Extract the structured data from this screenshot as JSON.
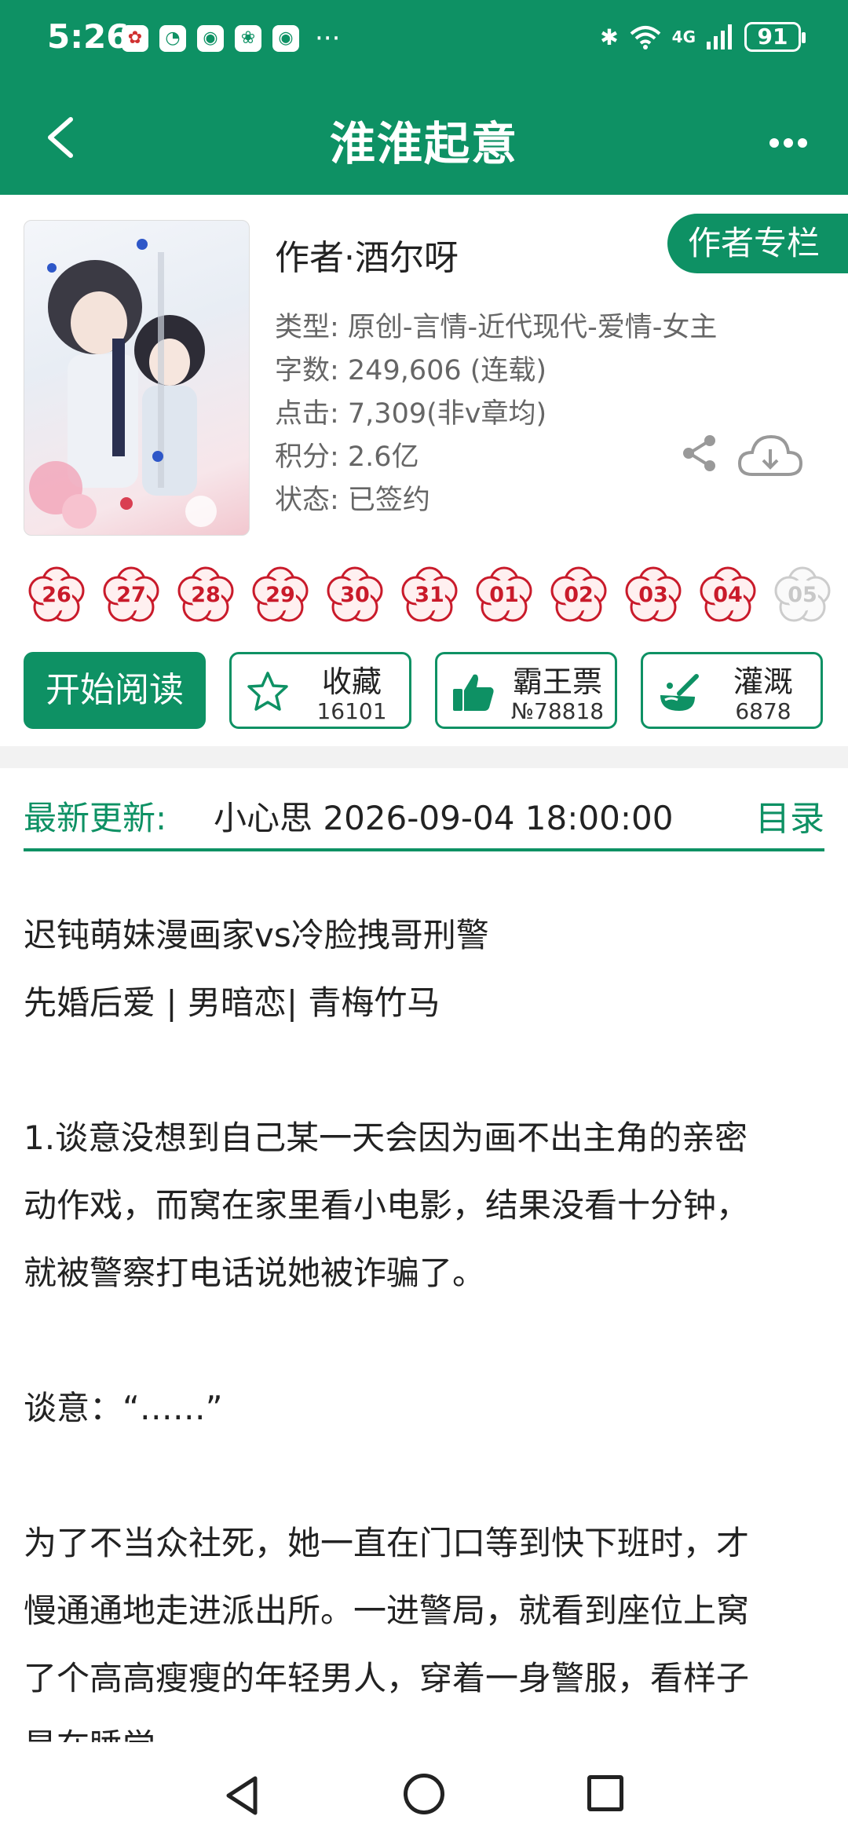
{
  "status_bar": {
    "time": "5:26",
    "network": "4G",
    "battery": "91"
  },
  "header": {
    "title": "淮淮起意",
    "back_icon": "chevron-left-icon",
    "more_icon": "more-dots-icon"
  },
  "book": {
    "author": "作者·酒尔呀",
    "author_column_label": "作者专栏",
    "meta": {
      "type": "类型: 原创-言情-近代现代-爱情-女主",
      "words": "字数: 249,606 (连载)",
      "clicks": "点击: 7,309(非v章均)",
      "points": "积分: 2.6亿",
      "status": "状态: 已签约"
    }
  },
  "update_days": [
    {
      "label": "26",
      "active": true
    },
    {
      "label": "27",
      "active": true
    },
    {
      "label": "28",
      "active": true
    },
    {
      "label": "29",
      "active": true
    },
    {
      "label": "30",
      "active": true
    },
    {
      "label": "31",
      "active": true
    },
    {
      "label": "01",
      "active": true
    },
    {
      "label": "02",
      "active": true
    },
    {
      "label": "03",
      "active": true
    },
    {
      "label": "04",
      "active": true
    },
    {
      "label": "05",
      "active": false
    }
  ],
  "actions": {
    "read_label": "开始阅读",
    "favorite": {
      "label": "收藏",
      "count": "16101"
    },
    "tickets": {
      "label": "霸王票",
      "count": "№78818"
    },
    "nutrient": {
      "label": "灌溉",
      "count": "6878"
    }
  },
  "latest": {
    "label": "最新更新:",
    "chapter": "小心思  2026-09-04 18:00:00",
    "toc_label": "目录"
  },
  "description": [
    "迟钝萌妹漫画家vs冷脸拽哥刑警",
    "先婚后爱 | 男暗恋| 青梅竹马",
    "",
    "1.谈意没想到自己某一天会因为画不出主角的亲密",
    "动作戏，而窝在家里看小电影，结果没看十分钟，",
    "就被警察打电话说她被诈骗了。",
    "",
    "谈意：“……”",
    "",
    "为了不当众社死，她一直在门口等到快下班时，才",
    "慢通通地走进派出所。一进警局，就看到座位上窝",
    "了个高高瘦瘦的年轻男人，穿着一身警服，看样子",
    "是在睡觉"
  ],
  "colors": {
    "brand": "#0e9164",
    "flower_red": "#c91a2a"
  }
}
